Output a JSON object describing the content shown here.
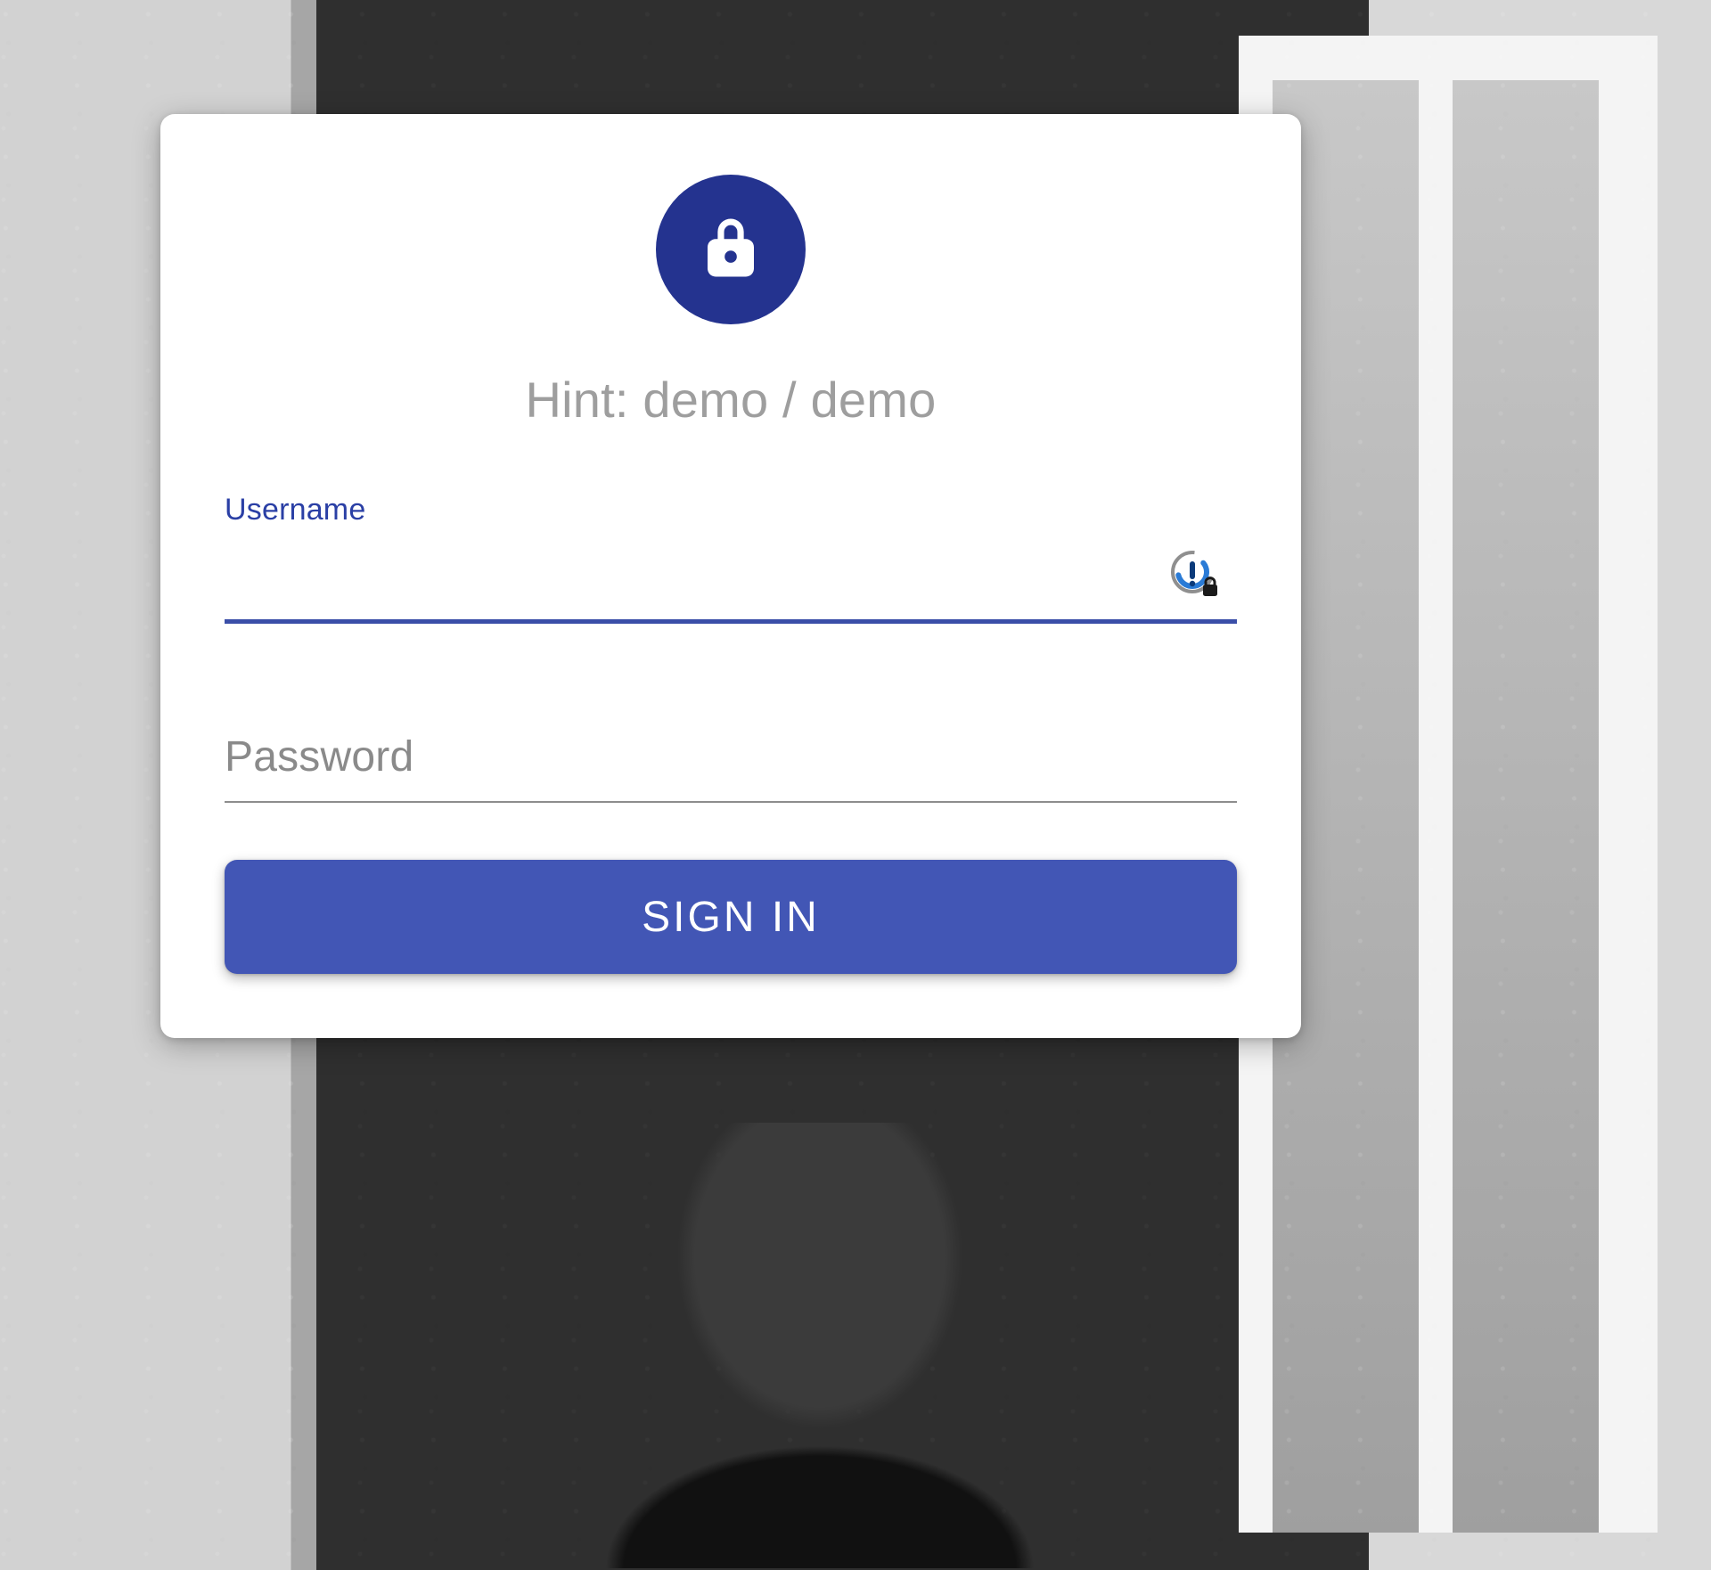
{
  "colors": {
    "primary": "#24338f",
    "button": "#4256b5",
    "labelFocused": "#2a3fa5",
    "placeholder": "#8a8a8a",
    "hint": "#9e9e9e"
  },
  "login": {
    "hint": "Hint: demo / demo",
    "avatar_icon": "lock-icon",
    "username": {
      "label": "Username",
      "value": "",
      "focused": true,
      "trailing_icon": "password-manager-icon"
    },
    "password": {
      "label": "Password",
      "value": "",
      "focused": false
    },
    "submit_label": "SIGN IN"
  }
}
